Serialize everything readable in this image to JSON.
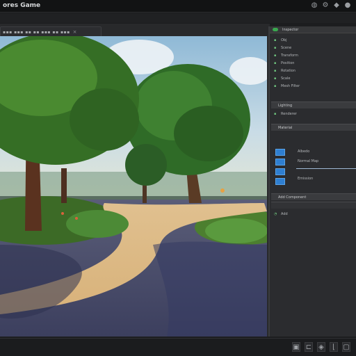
{
  "app": {
    "title": "ores Game"
  },
  "title_icons": [
    {
      "name": "globe-icon",
      "glyph": "◍"
    },
    {
      "name": "settings-icon",
      "glyph": "⚙"
    },
    {
      "name": "lock-icon",
      "glyph": "◆"
    },
    {
      "name": "user-icon",
      "glyph": "●"
    }
  ],
  "inspector": {
    "tab": "Inspector",
    "rows": [
      {
        "glyph": "▪",
        "text": "Obj"
      },
      {
        "glyph": "▪",
        "text": "Scene"
      },
      {
        "glyph": "▪",
        "text": "Transform"
      },
      {
        "glyph": "▪",
        "text": "Position"
      },
      {
        "glyph": "▪",
        "text": "Rotation"
      },
      {
        "glyph": "▪",
        "text": "Scale"
      },
      {
        "glyph": "▪",
        "text": "Mesh Filter"
      },
      {
        "glyph": "▪",
        "text": "Renderer"
      }
    ],
    "section1": "Lighting",
    "section2": "Material",
    "material_rows": [
      "Albedo",
      "Normal Map",
      "Emission"
    ],
    "section3": "Add Component"
  },
  "status_icons": [
    {
      "name": "layout-icon",
      "glyph": "▣"
    },
    {
      "name": "align-icon",
      "glyph": "⊏"
    },
    {
      "name": "shield-icon",
      "glyph": "◈"
    },
    {
      "name": "bracket-icon",
      "glyph": "⌊"
    },
    {
      "name": "window-icon",
      "glyph": "▢"
    }
  ],
  "colors": {
    "sky": "#9dc3dc",
    "foliage": "#3f7a2c",
    "path": "#d9b98a",
    "accent_blue": "#2f7fd1",
    "accent_green": "#3aa84f"
  }
}
